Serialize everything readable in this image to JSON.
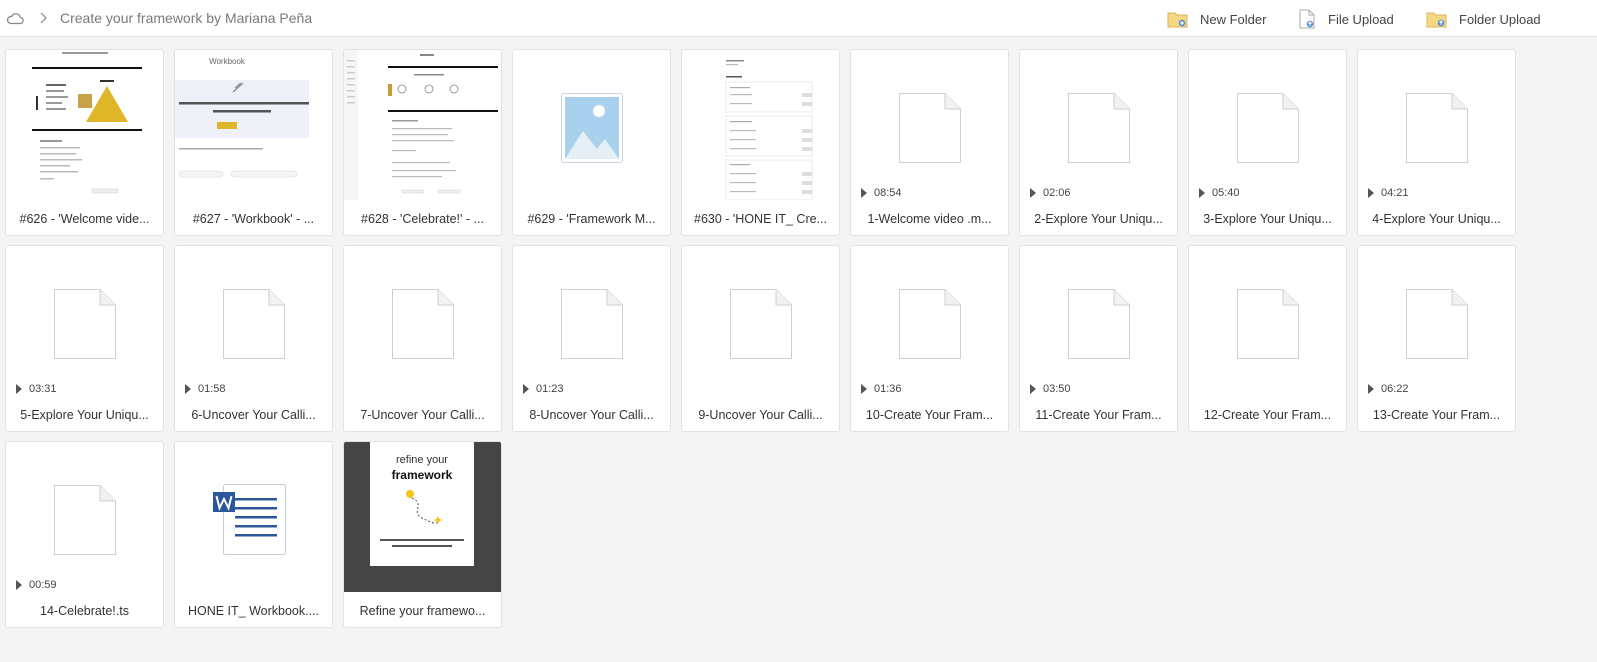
{
  "breadcrumb": {
    "title": "Create your framework by Mariana Peña"
  },
  "actions": {
    "new_folder": "New Folder",
    "file_upload": "File Upload",
    "folder_upload": "Folder Upload"
  },
  "files": [
    {
      "name": "#626 - 'Welcome vide...",
      "thumb": "doc-preview"
    },
    {
      "name": "#627 - 'Workbook' - ...",
      "thumb": "doc-preview"
    },
    {
      "name": "#628 - 'Celebrate!' - ...",
      "thumb": "doc-preview"
    },
    {
      "name": "#629 - 'Framework M...",
      "thumb": "image-placeholder"
    },
    {
      "name": "#630 - 'HONE IT_ Cre...",
      "thumb": "doc-preview"
    },
    {
      "name": "1-Welcome video .m...",
      "duration": "08:54"
    },
    {
      "name": "2-Explore Your Uniqu...",
      "duration": "02:06"
    },
    {
      "name": "3-Explore Your Uniqu...",
      "duration": "05:40"
    },
    {
      "name": "4-Explore Your Uniqu...",
      "duration": "04:21"
    },
    {
      "name": "5-Explore Your Uniqu...",
      "duration": "03:31"
    },
    {
      "name": "6-Uncover Your Calli...",
      "duration": "01:58"
    },
    {
      "name": "7-Uncover Your Calli..."
    },
    {
      "name": "8-Uncover Your Calli...",
      "duration": "01:23"
    },
    {
      "name": "9-Uncover Your Calli..."
    },
    {
      "name": "10-Create Your Fram...",
      "duration": "01:36"
    },
    {
      "name": "11-Create Your Fram...",
      "duration": "03:50"
    },
    {
      "name": "12-Create Your Fram..."
    },
    {
      "name": "13-Create Your Fram...",
      "duration": "06:22"
    },
    {
      "name": "14-Celebrate!.ts",
      "duration": "00:59"
    },
    {
      "name": "HONE IT_ Workbook....",
      "thumb": "word-icon"
    },
    {
      "name": "Refine your framewo...",
      "thumb": "framework-cover"
    }
  ],
  "cover": {
    "line1": "refine your",
    "line2": "framework"
  },
  "doc_previews": {
    "workbook_title": "Workbook"
  },
  "colors": {
    "folder": "#f5d682",
    "accent": "#4a8ad6",
    "word_blue": "#2b579a",
    "cover_bg": "#454545"
  }
}
